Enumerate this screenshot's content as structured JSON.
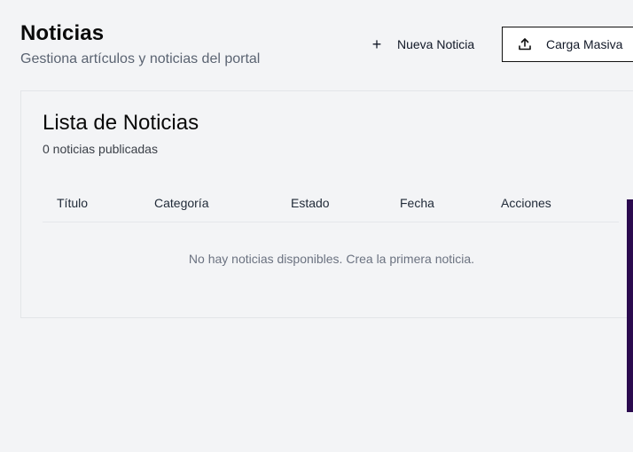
{
  "header": {
    "title": "Noticias",
    "subtitle": "Gestiona artículos y noticias del portal",
    "new_button_label": "Nueva Noticia",
    "new_button_icon": "plus-icon",
    "upload_button_label": "Carga Masiva",
    "upload_button_icon": "upload-icon"
  },
  "card": {
    "title": "Lista de Noticias",
    "subtitle": "0 noticias publicadas",
    "columns": [
      "Título",
      "Categoría",
      "Estado",
      "Fecha",
      "Acciones"
    ],
    "empty_message": "No hay noticias disponibles. Crea la primera noticia."
  },
  "colors": {
    "background": "#f3f4f6",
    "side_accent": "#2b0a4f",
    "muted_text": "#6b7280"
  }
}
